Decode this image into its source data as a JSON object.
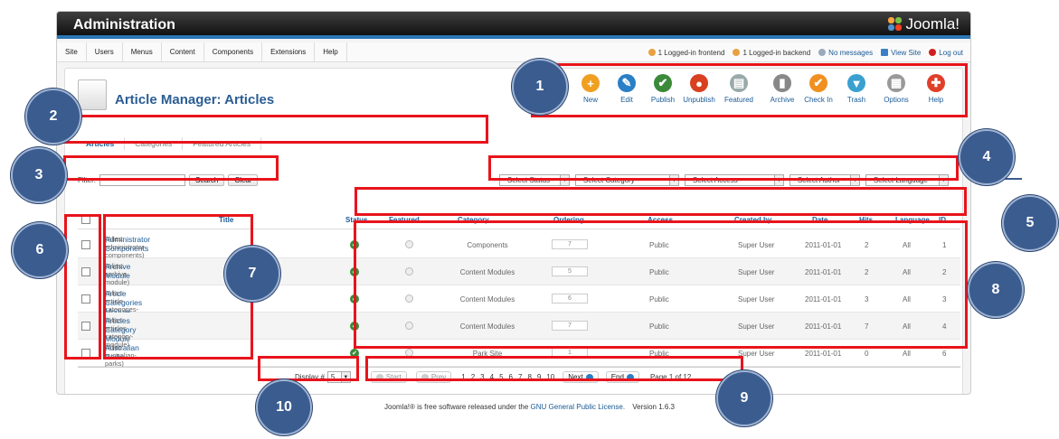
{
  "header": {
    "title": "Administration",
    "logo": "Joomla!"
  },
  "menu": [
    "Site",
    "Users",
    "Menus",
    "Content",
    "Components",
    "Extensions",
    "Help"
  ],
  "status": {
    "frontend": "1 Logged-in frontend",
    "backend": "1 Logged-in backend",
    "messages": "No messages",
    "view_site": "View Site",
    "logout": "Log out"
  },
  "page_title": "Article Manager: Articles",
  "toolbar": [
    {
      "label": "New",
      "icon": "plus-icon",
      "color": "#f0a020",
      "glyph": "+"
    },
    {
      "label": "Edit",
      "icon": "pencil-icon",
      "color": "#2a7fc6",
      "glyph": "✎"
    },
    {
      "label": "Publish",
      "icon": "check-icon",
      "color": "#3a8a3a",
      "glyph": "✔"
    },
    {
      "label": "Unpublish",
      "icon": "stop-icon",
      "color": "#d84020",
      "glyph": "●"
    },
    {
      "label": "Featured",
      "icon": "featured-icon",
      "color": "#9aa",
      "glyph": "▤"
    },
    {
      "label": "Archive",
      "icon": "archive-icon",
      "color": "#888",
      "glyph": "▮"
    },
    {
      "label": "Check In",
      "icon": "checkmark-icon",
      "color": "#f09020",
      "glyph": "✔"
    },
    {
      "label": "Trash",
      "icon": "trash-icon",
      "color": "#39a0d0",
      "glyph": "▼"
    },
    {
      "label": "Options",
      "icon": "options-icon",
      "color": "#999",
      "glyph": "▦"
    },
    {
      "label": "Help",
      "icon": "lifebuoy-icon",
      "color": "#e0402a",
      "glyph": "✚"
    }
  ],
  "tabs": [
    "Articles",
    "Categories",
    "Featured Articles"
  ],
  "filter": {
    "label": "Filter:",
    "value": "",
    "search": "Search",
    "clear": "Clear"
  },
  "selects": [
    "- Select Status -",
    "- Select Category -",
    "- Select Access -",
    "- Select Author -",
    "- Select Language -"
  ],
  "columns": {
    "title": "Title",
    "status": "Status",
    "featured": "Featured",
    "category": "Category",
    "ordering": "Ordering",
    "access": "Access",
    "created_by": "Created by",
    "date": "Date",
    "hits": "Hits",
    "language": "Language",
    "id": "ID"
  },
  "rows": [
    {
      "title": "Administrator Components",
      "alias": "(Alias: administrator-components)",
      "category": "Components",
      "ordering": "7",
      "access": "Public",
      "created_by": "Super User",
      "date": "2011-01-01",
      "hits": "2",
      "language": "All",
      "id": "1"
    },
    {
      "title": "Archive Module",
      "alias": "(Alias: archive-module)",
      "category": "Content Modules",
      "ordering": "5",
      "access": "Public",
      "created_by": "Super User",
      "date": "2011-01-01",
      "hits": "2",
      "language": "All",
      "id": "2"
    },
    {
      "title": "Article Categories Module",
      "alias": "(Alias: article-categories-module)",
      "category": "Content Modules",
      "ordering": "6",
      "access": "Public",
      "created_by": "Super User",
      "date": "2011-01-01",
      "hits": "3",
      "language": "All",
      "id": "3"
    },
    {
      "title": "Articles Category Module",
      "alias": "(Alias: articles-category-module)",
      "category": "Content Modules",
      "ordering": "7",
      "access": "Public",
      "created_by": "Super User",
      "date": "2011-01-01",
      "hits": "7",
      "language": "All",
      "id": "4"
    },
    {
      "title": "Australian Parks",
      "alias": "(Alias: australian-parks)",
      "category": "Park Site",
      "ordering": "1",
      "access": "Public",
      "created_by": "Super User",
      "date": "2011-01-01",
      "hits": "0",
      "language": "All",
      "id": "6"
    }
  ],
  "pager": {
    "display_label": "Display #",
    "display_value": "5",
    "start": "Start",
    "prev": "Prev",
    "pages": [
      "1",
      "2",
      "3",
      "4",
      "5",
      "6",
      "7",
      "8",
      "9",
      "10"
    ],
    "next": "Next",
    "end": "End",
    "page_info": "Page 1 of 12"
  },
  "footer": {
    "pre": "Joomla!® is free software released under the",
    "link": "GNU General Public License.",
    "version": "Version 1.6.3"
  },
  "callouts": [
    "1",
    "2",
    "3",
    "4",
    "5",
    "6",
    "7",
    "8",
    "9",
    "10"
  ]
}
